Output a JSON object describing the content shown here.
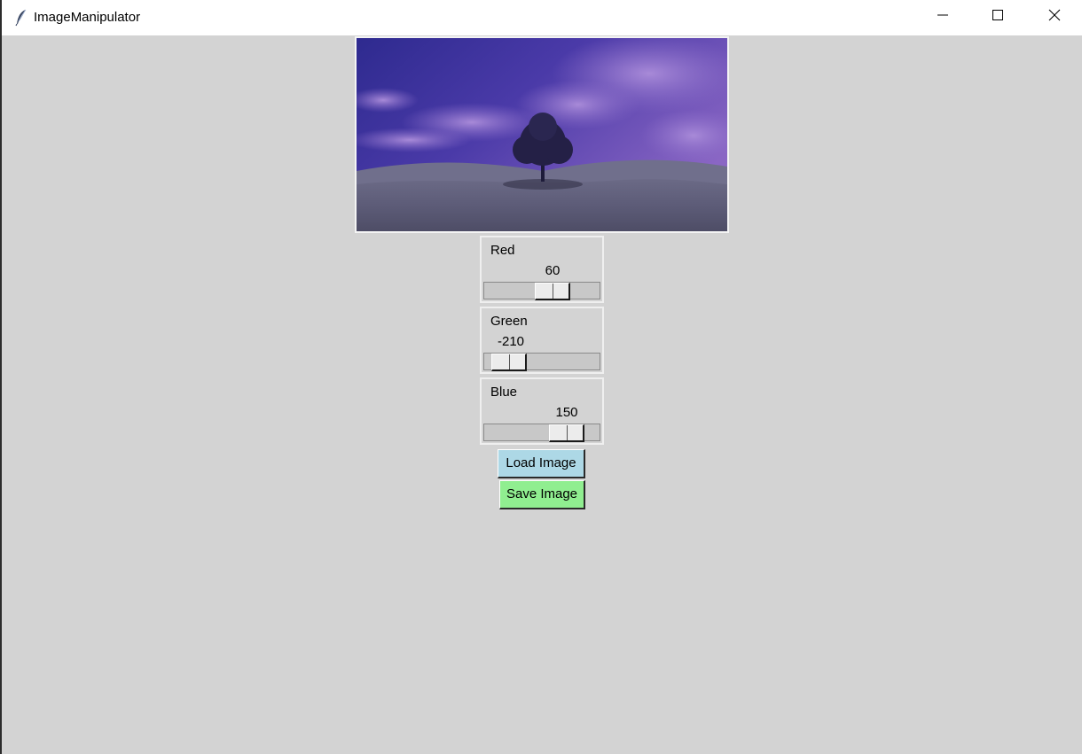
{
  "window": {
    "title": "ImageManipulator"
  },
  "icons": {
    "app": "feather-icon",
    "minimize": "minimize-icon",
    "maximize": "maximize-icon",
    "close": "close-icon"
  },
  "sliders": [
    {
      "label": "Red",
      "value": "60",
      "position": 0.587
    },
    {
      "label": "Green",
      "value": "-210",
      "position": 0.229
    },
    {
      "label": "Blue",
      "value": "150",
      "position": 0.705
    }
  ],
  "buttons": {
    "load_label": "Load Image",
    "save_label": "Save Image"
  },
  "colors": {
    "background": "#d3d3d3",
    "load_button": "#add8e6",
    "save_button": "#90ee90"
  }
}
